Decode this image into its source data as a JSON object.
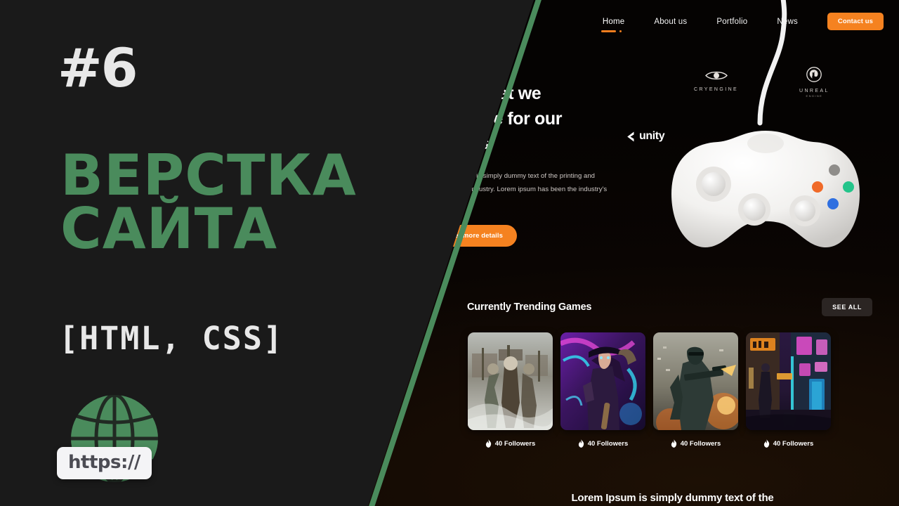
{
  "left": {
    "episode": "#6",
    "title_line1": "ВЕРСТКА",
    "title_line2": "САЙТА",
    "subtitle": "[HTML, CSS]",
    "logo_text": "https://",
    "accent_green": "#4a8b5c",
    "background": "#1a1a1a",
    "text_light": "#e8e8e8"
  },
  "site": {
    "accent_orange": "#f58220",
    "nav": {
      "items": [
        {
          "label": "Home",
          "active": true
        },
        {
          "label": "About us",
          "active": false
        },
        {
          "label": "Portfolio",
          "active": false
        },
        {
          "label": "News",
          "active": false
        }
      ],
      "cta_label": "Contact us"
    },
    "hero": {
      "heading_line1": "Work that we",
      "heading_line2": "produce for our",
      "heading_line3": "clients",
      "paragraph": "Lorem ipsum is simply dummy text of the printing and typesetting industry. Lorem ipsum has been the industry's standard.",
      "button_label": "Get more details"
    },
    "brands": [
      {
        "name": "CRYENGINE",
        "sub": "",
        "icon": "cryengine-eye-icon"
      },
      {
        "name": "UNREAL",
        "sub": "ENGINE",
        "icon": "unreal-engine-icon"
      },
      {
        "name": "unity",
        "sub": "",
        "icon": "unity-cube-icon"
      }
    ],
    "trending": {
      "title": "Currently Trending Games",
      "see_all_label": "SEE ALL",
      "cards": [
        {
          "art": "warriors-battle",
          "followers": "40 Followers"
        },
        {
          "art": "neon-fantasy-hero",
          "followers": "40 Followers"
        },
        {
          "art": "soldier-explosion",
          "followers": "40 Followers"
        },
        {
          "art": "cyberpunk-street",
          "followers": "40 Followers"
        }
      ]
    },
    "footer_lorem": "Lorem Ipsum is simply dummy text of the"
  }
}
